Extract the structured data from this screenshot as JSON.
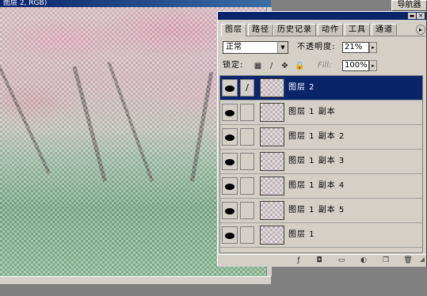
{
  "canvas": {
    "title_fragment": "图层 2, RGB)"
  },
  "navigator_tab": {
    "label": "导航器"
  },
  "palette": {
    "min_glyph": "▬",
    "close_glyph": "✕",
    "menu_glyph": "▸",
    "tabs": [
      {
        "label": "图层",
        "active": true
      },
      {
        "label": "路径",
        "active": false
      },
      {
        "label": "历史记录",
        "active": false
      },
      {
        "label": "动作",
        "active": false
      },
      {
        "label": "工具",
        "active": false
      },
      {
        "label": "通道",
        "active": false
      }
    ],
    "blend_mode": "正常",
    "opacity_label": "不透明度:",
    "opacity_value": "21%",
    "lock_label": "锁定:",
    "fill_label": "Fill:",
    "fill_value": "100%",
    "arrow_glyph": "▸",
    "dropdown_glyph": "▼",
    "lock_icons": [
      "lock-transparent-icon",
      "lock-image-icon",
      "lock-position-icon",
      "lock-all-icon"
    ],
    "lock_glyphs": [
      "▦",
      "∕",
      "✥",
      "🔒"
    ],
    "brush_glyph": "∕",
    "layers": [
      {
        "name": "图层 2",
        "selected": true,
        "brush": true
      },
      {
        "name": "图层 1 副本",
        "selected": false,
        "brush": false
      },
      {
        "name": "图层 1 副本 2",
        "selected": false,
        "brush": false
      },
      {
        "name": "图层 1 副本 3",
        "selected": false,
        "brush": false
      },
      {
        "name": "图层 1 副本 4",
        "selected": false,
        "brush": false
      },
      {
        "name": "图层 1 副本 5",
        "selected": false,
        "brush": false
      },
      {
        "name": "图层 1",
        "selected": false,
        "brush": false
      }
    ],
    "bottom_buttons": [
      {
        "icon": "layer-style-icon",
        "glyph": "ƒ"
      },
      {
        "icon": "layer-mask-icon",
        "glyph": "◘"
      },
      {
        "icon": "new-set-icon",
        "glyph": "▭"
      },
      {
        "icon": "adjustment-layer-icon",
        "glyph": "◐"
      },
      {
        "icon": "new-layer-icon",
        "glyph": "❐"
      },
      {
        "icon": "delete-layer-icon",
        "glyph": "🗑"
      }
    ],
    "resize_glyph": "◢"
  }
}
